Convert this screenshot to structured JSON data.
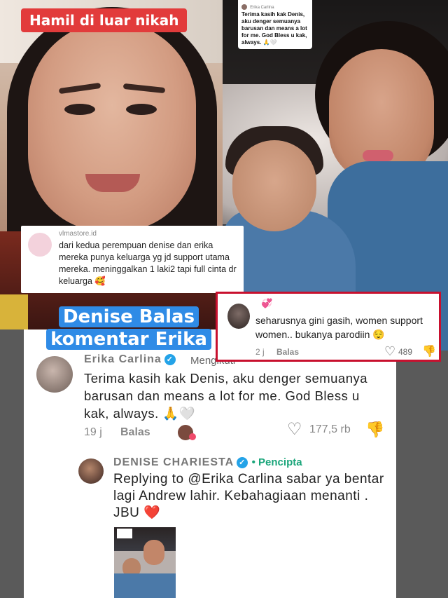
{
  "title_badge": "Hamil di luar nikah",
  "mini_comment": {
    "username": "Erika Carlina",
    "text": "Terima kasih kak Denis, aku denger semuanya barusan dan means a lot for me. God Bless u kak, always. 🙏🤍"
  },
  "left_comment": {
    "username": "vlmastore.id",
    "text": "dari kedua perempuan denise dan erika mereka punya keluarga yg jd support utama mereka. meninggalkan 1 laki2 tapi full cinta dr keluarga 🥰"
  },
  "headline": "Denise Balas komentar Erika",
  "red_comment": {
    "username": "",
    "username_suffix": "💞",
    "text": "seharusnya gini gasih, women support women.. bukanya parodiin 😌",
    "time": "2 j",
    "reply_label": "Balas",
    "likes": "489",
    "heart_icon": "♡",
    "dislike_icon": "👎"
  },
  "comment_main": {
    "username": "Erika Carlina",
    "verified_icon": "✓",
    "follow_label": "Mengikuti",
    "text": "Terima kasih kak Denis, aku denger semuanya barusan dan means a lot for me. God Bless u kak, always. 🙏🤍",
    "time": "19 j",
    "reply_label": "Balas",
    "likes": "177,5 rb",
    "heart_icon": "♡",
    "dislike_icon": "👎"
  },
  "comment_reply": {
    "username": "DENISE CHARIESTA",
    "verified_icon": "✓",
    "creator_label": "• Pencipta",
    "text": "Replying to @Erika Carlina sabar ya bentar lagi Andrew lahir. Kebahagiaan menanti . JBU ❤️"
  },
  "colors": {
    "badge_red": "#e23b3b",
    "headline_blue": "#2f8be6",
    "highlight_border": "#c8102e",
    "verified_blue": "#24a3e8",
    "creator_green": "#1aa57a"
  }
}
